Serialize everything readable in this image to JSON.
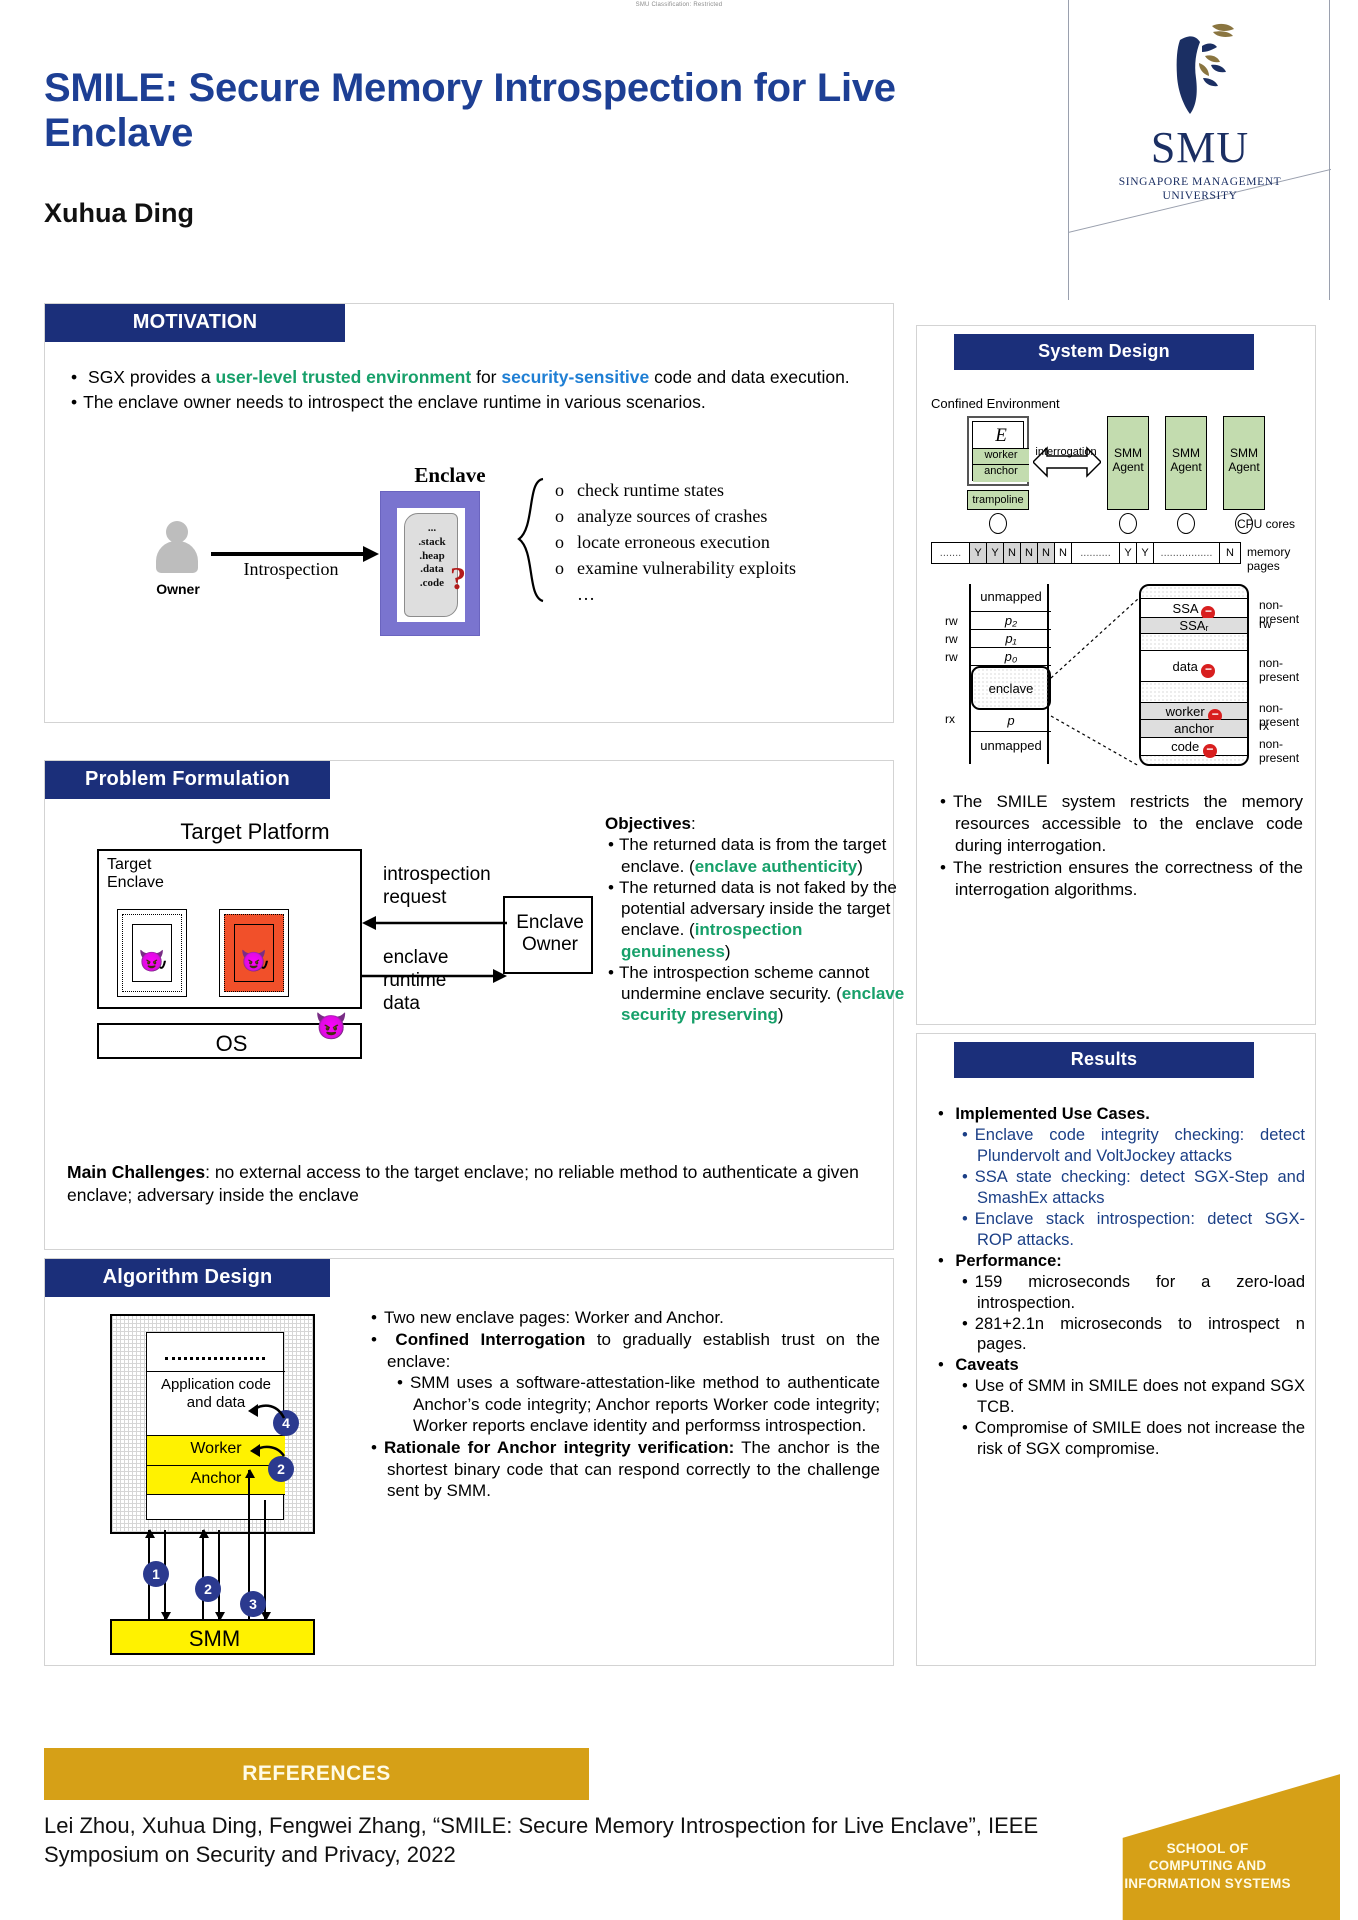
{
  "classification": "SMU Classification: Restricted",
  "header": {
    "title": "SMILE: Secure Memory Introspection for Live Enclave",
    "author": "Xuhua Ding",
    "logo": {
      "word": "SMU",
      "sub_line1": "SINGAPORE MANAGEMENT",
      "sub_line2": "UNIVERSITY"
    },
    "title_color": "#1d3f94"
  },
  "motivation": {
    "heading": "MOTIVATION",
    "bullets": [
      {
        "segments": [
          {
            "text": "SGX provides a ",
            "style": "plain"
          },
          {
            "text": "user-level trusted environment",
            "style": "green"
          },
          {
            "text": " for ",
            "style": "plain"
          },
          {
            "text": "security-sensitive",
            "style": "blue"
          },
          {
            "text": " code and data execution.",
            "style": "plain"
          }
        ]
      },
      {
        "segments": [
          {
            "text": "The enclave owner needs to introspect the enclave runtime in various scenarios.",
            "style": "plain"
          }
        ]
      }
    ],
    "figure": {
      "enclave_label": "Enclave",
      "owner_label": "Owner",
      "arrow_label": "Introspection",
      "scroll_lines": [
        "...",
        ".stack",
        ".heap",
        ".data",
        ".code"
      ],
      "question_mark": "?",
      "items": [
        "check runtime states",
        "analyze sources of crashes",
        "locate erroneous execution",
        "examine vulnerability exploits"
      ],
      "ellipsis": "…",
      "bullet_glyph": "o"
    }
  },
  "problem": {
    "heading": "Problem Formulation",
    "figure": {
      "target_platform": "Target Platform",
      "target_enclave": "Target\nEnclave",
      "target_enclave_l1": "Target",
      "target_enclave_l2": "Enclave",
      "os": "OS",
      "enclave_owner_l1": "Enclave",
      "enclave_owner_l2": "Owner",
      "introspection_request_l1": "introspection",
      "introspection_request_l2": "request",
      "runtime_data_l1": "enclave",
      "runtime_data_l2": "runtime",
      "runtime_data_l3": "data"
    },
    "objectives_heading": "Objectives",
    "objectives": [
      {
        "pre": "The returned data is from the target enclave. (",
        "hl": "enclave authenticity",
        "post": ")"
      },
      {
        "pre": "The returned data is not faked by the potential adversary inside the target enclave. (",
        "hl": "introspection genuineness",
        "post": ")"
      },
      {
        "pre": "The introspection scheme cannot undermine enclave security. (",
        "hl": "enclave security preserving",
        "post": ")"
      }
    ],
    "challenges_label": "Main Challenges",
    "challenges_text": ": no external access to the target enclave; no reliable method to authenticate a given enclave; adversary inside the enclave"
  },
  "algorithm": {
    "heading": "Algorithm Design",
    "figure": {
      "app_label": "Application code and data",
      "worker": "Worker",
      "anchor": "Anchor",
      "smm": "SMM",
      "badges": [
        "1",
        "2",
        "3",
        "4",
        "2"
      ]
    },
    "bullets": [
      {
        "bold": "",
        "text": "Two new enclave pages: Worker and Anchor.",
        "sub": []
      },
      {
        "bold": "Confined Interrogation",
        "text": " to gradually establish trust on the enclave:",
        "sub": [
          "SMM uses a software-attestation-like method to authenticate Anchor’s code integrity; Anchor reports Worker code integrity; Worker reports enclave identity and performss introspection."
        ]
      },
      {
        "bold": "Rationale for Anchor integrity verification:",
        "text": " The anchor is the shortest binary code that can respond correctly to the challenge sent by SMM.",
        "sub": []
      }
    ],
    "sub_italics": [
      "software-attestation",
      "shortest binary code"
    ]
  },
  "system": {
    "heading": "System Design",
    "figure": {
      "confined_env": "Confined Environment",
      "enclave_letter": "E",
      "worker": "worker",
      "anchor": "anchor",
      "trampoline": "trampoline",
      "interrogation": "interrogation",
      "agents": [
        "SMM Agent",
        "SMM Agent",
        "SMM Agent"
      ],
      "agent_l1": "SMM",
      "agent_l2": "Agent",
      "cpu_cores_label": "CPU cores",
      "memory_pages_label": "memory pages",
      "page_flags": [
        "Y",
        "Y",
        "N",
        "N",
        "N",
        "N",
        "Y",
        "Y",
        "N"
      ],
      "page_table": {
        "left_rows": [
          "unmapped",
          "p₂",
          "p₁",
          "p₀",
          "enclave",
          "p",
          "unmapped"
        ],
        "left_perms": [
          "rw",
          "rw",
          "rw",
          "rx"
        ],
        "right_rows": [
          "SSA",
          "SSAᵣ",
          "",
          "data",
          "",
          "worker",
          "anchor",
          "code"
        ],
        "right_notes": [
          "non-present",
          "rw",
          "non-present",
          "non-present",
          "rx",
          "non-present"
        ]
      }
    },
    "bullets": [
      "The SMILE system restricts the memory resources accessible to the enclave code during interrogation.",
      "The restriction ensures the correctness of the interrogation algorithms."
    ]
  },
  "results": {
    "heading": "Results",
    "groups": [
      {
        "title": "Implemented Use Cases.",
        "items": [
          "Enclave code integrity checking: detect Plundervolt and VoltJockey attacks",
          "SSA state checking: detect SGX-Step and SmashEx attacks",
          "Enclave stack introspection: detect SGX-ROP attacks."
        ]
      },
      {
        "title": "Performance:",
        "items": [
          "159 microseconds for a zero-load introspection.",
          "281+2.1n microseconds to introspect n pages."
        ]
      },
      {
        "title": "Caveats",
        "items": [
          "Use of SMM in SMILE does not expand SGX TCB.",
          "Compromise of SMILE does not increase the risk of SGX compromise."
        ]
      }
    ]
  },
  "references": {
    "heading": "REFERENCES",
    "citation": "Lei Zhou, Xuhua Ding, Fengwei Zhang, “SMILE: Secure Memory Introspection for Live Enclave”, IEEE Symposium on Security and Privacy, 2022"
  },
  "school": {
    "line1": "SCHOOL OF",
    "line2": "COMPUTING AND",
    "line3": "INFORMATION SYSTEMS",
    "color": "#d6a017"
  },
  "colors": {
    "header_bar": "#1b2f7a",
    "gold": "#d6a017",
    "green_highlight": "#17a06a",
    "blue_highlight": "#1f7fd4",
    "results_blue": "#1b3f86"
  }
}
